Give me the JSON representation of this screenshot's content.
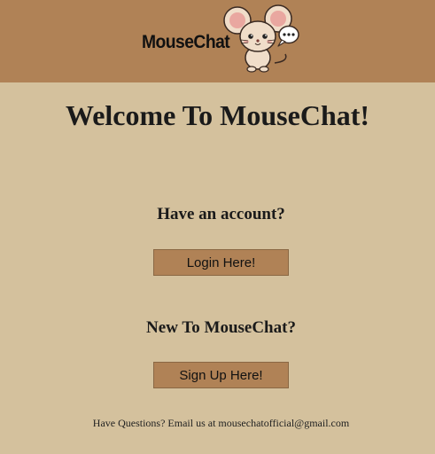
{
  "header": {
    "brand": "MouseChat",
    "logo_icon": "mouse-mascot-with-chat-bubble"
  },
  "main": {
    "title": "Welcome To MouseChat!",
    "login_section": {
      "heading": "Have an account?",
      "button_label": "Login Here!"
    },
    "signup_section": {
      "heading": "New To MouseChat?",
      "button_label": "Sign Up Here!"
    }
  },
  "footer": {
    "text": "Have Questions? Email us at mousechatofficial@gmail.com"
  },
  "colors": {
    "page_background": "#d4c19d",
    "header_background": "#b08256",
    "button_background": "#b08256"
  }
}
